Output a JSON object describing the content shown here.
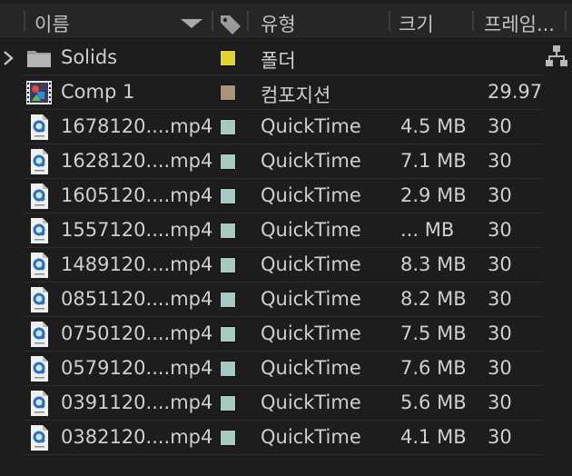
{
  "header": {
    "name_label": "이름",
    "label_icon": "tag-icon",
    "type_label": "유형",
    "size_label": "크기",
    "framerate_label": "프레임..."
  },
  "colors": {
    "label_yellow": "#e0d437",
    "label_tan": "#a8957a",
    "label_aqua": "#a7c9c0"
  },
  "items": [
    {
      "name": "Solids",
      "icon": "folder-icon",
      "label_color": "#e0d437",
      "type": "폴더",
      "size": "",
      "framerate": "",
      "expandable": true
    },
    {
      "name": "Comp 1",
      "icon": "composition-icon",
      "label_color": "#a8957a",
      "type": "컴포지션",
      "size": "",
      "framerate": "29.97",
      "expandable": false
    },
    {
      "name": "1678120....mp4",
      "icon": "quicktime-file-icon",
      "label_color": "#a7c9c0",
      "type": "QuickTime",
      "size": "4.5 MB",
      "framerate": "30",
      "expandable": false
    },
    {
      "name": "1628120....mp4",
      "icon": "quicktime-file-icon",
      "label_color": "#a7c9c0",
      "type": "QuickTime",
      "size": "7.1 MB",
      "framerate": "30",
      "expandable": false
    },
    {
      "name": "1605120....mp4",
      "icon": "quicktime-file-icon",
      "label_color": "#a7c9c0",
      "type": "QuickTime",
      "size": "2.9 MB",
      "framerate": "30",
      "expandable": false
    },
    {
      "name": "1557120....mp4",
      "icon": "quicktime-file-icon",
      "label_color": "#a7c9c0",
      "type": "QuickTime",
      "size": "... MB",
      "framerate": "30",
      "expandable": false
    },
    {
      "name": "1489120....mp4",
      "icon": "quicktime-file-icon",
      "label_color": "#a7c9c0",
      "type": "QuickTime",
      "size": "8.3 MB",
      "framerate": "30",
      "expandable": false
    },
    {
      "name": "0851120....mp4",
      "icon": "quicktime-file-icon",
      "label_color": "#a7c9c0",
      "type": "QuickTime",
      "size": "8.2 MB",
      "framerate": "30",
      "expandable": false
    },
    {
      "name": "0750120....mp4",
      "icon": "quicktime-file-icon",
      "label_color": "#a7c9c0",
      "type": "QuickTime",
      "size": "7.5 MB",
      "framerate": "30",
      "expandable": false
    },
    {
      "name": "0579120....mp4",
      "icon": "quicktime-file-icon",
      "label_color": "#a7c9c0",
      "type": "QuickTime",
      "size": "7.6 MB",
      "framerate": "30",
      "expandable": false
    },
    {
      "name": "0391120....mp4",
      "icon": "quicktime-file-icon",
      "label_color": "#a7c9c0",
      "type": "QuickTime",
      "size": "5.6 MB",
      "framerate": "30",
      "expandable": false
    },
    {
      "name": "0382120....mp4",
      "icon": "quicktime-file-icon",
      "label_color": "#a7c9c0",
      "type": "QuickTime",
      "size": "4.1 MB",
      "framerate": "30",
      "expandable": false
    }
  ],
  "flowchart_icon": "flowchart-icon"
}
